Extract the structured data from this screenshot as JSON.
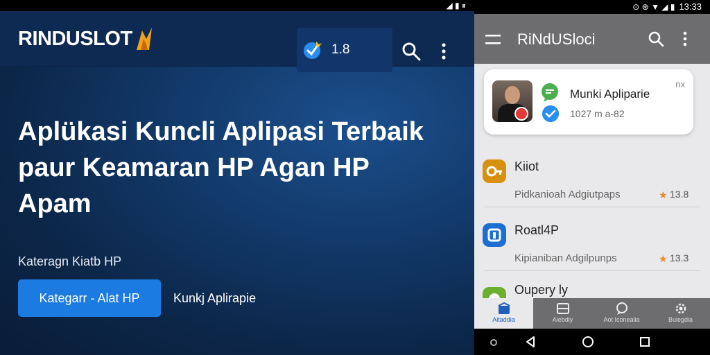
{
  "hero": {
    "status_icons": "◢ ▮ ⏸",
    "logo": "RINDUSLOT",
    "rating": "1.8",
    "headline": "Aplükasi Kuncli Aplipasi Terbaik paur Keamaran HP Agan HP Apam",
    "category_label": "Kateragn Kiatb HP",
    "cta_label": "Kategarr - Alat HP",
    "cta_link": "Kunkj Aplirapie"
  },
  "phone": {
    "status_time": "13:33",
    "status_icons": "⊙ ⊛ ▼ ◢ ▮",
    "title": "RiNdUSloci",
    "featured": {
      "title": "Munki Apliparie",
      "subtitle": "1027 m a-82",
      "corner": "nx"
    },
    "items": [
      {
        "title": "Kiiot",
        "desc": "Pidkanioah Adgiutpaps",
        "score": "13.8",
        "icon_color": "#d8900f"
      },
      {
        "title": "Roatl4P",
        "desc": "Kipianiban Adgilpunps",
        "score": "13.3",
        "icon_color": "#1a6fd0"
      },
      {
        "title": "Oupery ly",
        "desc": "",
        "score": "",
        "icon_color": "#6cae2e"
      }
    ],
    "nav": [
      "Aitaddia",
      "Aiebdly",
      "Aot Iconealia",
      "Buiegdia"
    ]
  },
  "colors": {
    "hero_bg": "#0c2648",
    "cta": "#1b7be0",
    "appbar": "#6d6d70",
    "star": "#e8892a"
  }
}
